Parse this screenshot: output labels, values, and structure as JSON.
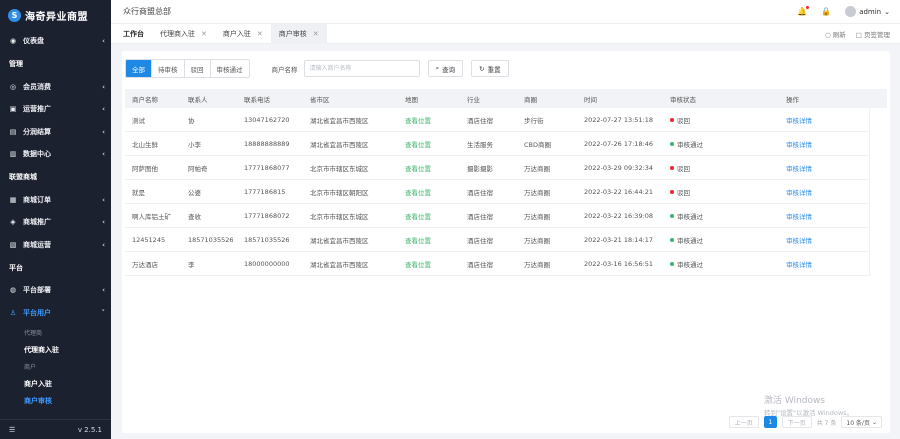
{
  "brand": {
    "logo_glyph": "S",
    "title": "海奇异业商盟"
  },
  "sidebar": {
    "items": [
      {
        "type": "item",
        "icon": "dashboard-icon",
        "glyph": "◉",
        "label": "仪表盘",
        "arrow": "‹"
      },
      {
        "type": "group",
        "label": "管理"
      },
      {
        "type": "item",
        "icon": "member-icon",
        "glyph": "◎",
        "label": "会员消费",
        "arrow": "‹"
      },
      {
        "type": "item",
        "icon": "promotion-icon",
        "glyph": "▣",
        "label": "运营推广",
        "arrow": "‹"
      },
      {
        "type": "item",
        "icon": "settlement-icon",
        "glyph": "▤",
        "label": "分润结算",
        "arrow": "‹"
      },
      {
        "type": "item",
        "icon": "data-center-icon",
        "glyph": "▥",
        "label": "数据中心",
        "arrow": "‹"
      },
      {
        "type": "group",
        "label": "联盟商城"
      },
      {
        "type": "item",
        "icon": "order-icon",
        "glyph": "▦",
        "label": "商城订单",
        "arrow": "‹"
      },
      {
        "type": "item",
        "icon": "mall-promo-icon",
        "glyph": "◈",
        "label": "商城推广",
        "arrow": "‹"
      },
      {
        "type": "item",
        "icon": "mall-ops-icon",
        "glyph": "▧",
        "label": "商城运营",
        "arrow": "‹"
      },
      {
        "type": "group",
        "label": "平台"
      },
      {
        "type": "item",
        "icon": "platform-icon",
        "glyph": "◍",
        "label": "平台部署",
        "arrow": "‹"
      },
      {
        "type": "item",
        "icon": "user-icon",
        "glyph": "♙",
        "label": "平台用户",
        "arrow": "˅",
        "active": true
      }
    ],
    "subitems": [
      {
        "type": "title",
        "label": "代理商"
      },
      {
        "type": "sub",
        "label": "代理商入驻"
      },
      {
        "type": "title",
        "label": "商户"
      },
      {
        "type": "sub",
        "label": "商户入驻"
      },
      {
        "type": "sub",
        "label": "商户审核",
        "active": true
      }
    ],
    "footer": {
      "menu_glyph": "☰",
      "version": "v 2.5.1"
    }
  },
  "header": {
    "org": "众行商盟总部",
    "username": "admin",
    "user_arrow": "⌄",
    "bell_glyph": "🔔",
    "lock_glyph": "🔒"
  },
  "tabs": {
    "items": [
      {
        "label": "工作台",
        "home": true
      },
      {
        "label": "代理商入驻",
        "closable": true
      },
      {
        "label": "商户入驻",
        "closable": true
      },
      {
        "label": "商户审核",
        "closable": true,
        "active": true
      }
    ],
    "close_glyph": "✕",
    "refresh_label": "○ 刷新",
    "manage_label": "□ 页签管理"
  },
  "filter": {
    "segments": [
      {
        "label": "全部",
        "on": true
      },
      {
        "label": "待审核"
      },
      {
        "label": "驳回"
      },
      {
        "label": "审核通过"
      }
    ],
    "name_label": "商户名称",
    "name_placeholder": "请输入商户名称",
    "query_label": "查询",
    "query_glyph": "⌕",
    "reset_label": "重置",
    "reset_glyph": "↻"
  },
  "table": {
    "headers": [
      "商户名称",
      "联系人",
      "联系电话",
      "省市区",
      "地图",
      "行业",
      "商圈",
      "时间",
      "审核状态",
      "操作"
    ],
    "rows": [
      {
        "name": "测试",
        "contact": "协",
        "phone": "13047162720",
        "region": "湖北省宜昌市西陵区",
        "map": "查看位置",
        "industry": "酒店住宿",
        "district": "步行街",
        "time": "2022-07-27 13:51:18",
        "status": "驳回",
        "status_color": "#f5222d",
        "op": "审核详情"
      },
      {
        "name": "北山生鲜",
        "contact": "小李",
        "phone": "18888888889",
        "region": "湖北省宜昌市西陵区",
        "map": "查看位置",
        "industry": "生活服务",
        "district": "CBD商圈",
        "time": "2022-07-26 17:18:46",
        "status": "审核通过",
        "status_color": "#3bb56f",
        "op": "审核详情"
      },
      {
        "name": "阿萨图他",
        "contact": "阿帕奇",
        "phone": "17771868077",
        "region": "北京市市辖区东城区",
        "map": "查看位置",
        "industry": "摄影摄影",
        "district": "万达商圈",
        "time": "2022-03-29 09:32:34",
        "status": "驳回",
        "status_color": "#f5222d",
        "op": "审核详情"
      },
      {
        "name": "就是",
        "contact": "公婆",
        "phone": "1777186815",
        "region": "北京市市辖区朝阳区",
        "map": "查看位置",
        "industry": "酒店住宿",
        "district": "万达商圈",
        "time": "2022-03-22 16:44:21",
        "status": "驳回",
        "status_color": "#f5222d",
        "op": "审核详情"
      },
      {
        "name": "啊人库铝土矿",
        "contact": "查收",
        "phone": "17771868072",
        "region": "北京市市辖区东城区",
        "map": "查看位置",
        "industry": "酒店住宿",
        "district": "万达商圈",
        "time": "2022-03-22 16:39:08",
        "status": "审核通过",
        "status_color": "#3bb56f",
        "op": "审核详情"
      },
      {
        "name": "12451245",
        "contact": "18571035526",
        "phone": "18571035526",
        "region": "湖北省宜昌市西陵区",
        "map": "查看位置",
        "industry": "酒店住宿",
        "district": "万达商圈",
        "time": "2022-03-21 18:14:17",
        "status": "审核通过",
        "status_color": "#3bb56f",
        "op": "审核详情"
      },
      {
        "name": "万达酒店",
        "contact": "李",
        "phone": "18000000000",
        "region": "湖北省宜昌市西陵区",
        "map": "查看位置",
        "industry": "酒店住宿",
        "district": "万达商圈",
        "time": "2022-03-16 16:56:51",
        "status": "审核通过",
        "status_color": "#3bb56f",
        "op": "审核详情"
      }
    ]
  },
  "pagination": {
    "prev": "上一页",
    "current": "1",
    "next": "下一页",
    "total": "共 7 条",
    "page_size": "10 条/页",
    "size_arrow": "⌄"
  },
  "watermark": {
    "line1": "激活 Windows",
    "line2": "转到\"设置\"以激活 Windows。"
  }
}
